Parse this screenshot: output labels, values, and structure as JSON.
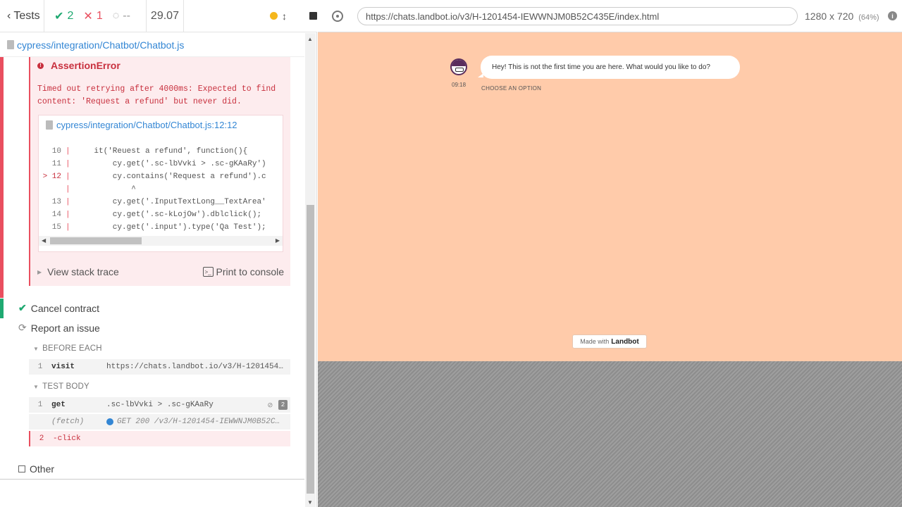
{
  "topbar": {
    "tests_label": "Tests",
    "passed": "2",
    "failed": "1",
    "pending": "--",
    "duration": "29.07"
  },
  "spec_file": "cypress/integration/Chatbot/Chatbot.js",
  "error": {
    "title": "AssertionError",
    "message": "Timed out retrying after 4000ms: Expected to find content: 'Request a refund' but never did.",
    "code_file": "cypress/integration/Chatbot/Chatbot.js:12:12",
    "code_lines": [
      {
        "num": "10",
        "marker": "",
        "code": "    it('Reuest a refund', function(){"
      },
      {
        "num": "11",
        "marker": "",
        "code": "        cy.get('.sc-lbVvki > .sc-gKAaRy')"
      },
      {
        "num": "12",
        "marker": "> ",
        "code": "        cy.contains('Request a refund').c"
      },
      {
        "num": "",
        "marker": "",
        "code": "            ^"
      },
      {
        "num": "13",
        "marker": "",
        "code": "        cy.get('.InputTextLong__TextArea'"
      },
      {
        "num": "14",
        "marker": "",
        "code": "        cy.get('.sc-kLojOw').dblclick();"
      },
      {
        "num": "15",
        "marker": "",
        "code": "        cy.get('.input').type('Qa Test');"
      }
    ],
    "view_stack_trace": "View stack trace",
    "print_to_console": "Print to console"
  },
  "tests": {
    "cancel_contract": "Cancel contract",
    "report_issue": "Report an issue",
    "other": "Other"
  },
  "hooks": {
    "before_each": "BEFORE EACH",
    "test_body": "TEST BODY"
  },
  "commands": {
    "visit": {
      "num": "1",
      "name": "visit",
      "msg": "https://chats.landbot.io/v3/H-1201454…"
    },
    "get": {
      "num": "1",
      "name": "get",
      "msg": ".sc-lbVvki > .sc-gKAaRy",
      "count": "2"
    },
    "fetch": {
      "name": "(fetch)",
      "msg": "GET 200 /v3/H-1201454-IEWWNJM0B52C…"
    },
    "click": {
      "num": "2",
      "name": "-click"
    }
  },
  "browser": {
    "url": "https://chats.landbot.io/v3/H-1201454-IEWWNJM0B52C435E/index.html",
    "viewport": "1280 x 720",
    "scale": "(64%)"
  },
  "chat": {
    "bot_message": "Hey! This is not the first time you are here. What would you like to do?",
    "time": "09:18",
    "choose_option": "CHOOSE AN OPTION",
    "made_with": "Made with",
    "brand": "Landbot"
  },
  "colors": {
    "pass": "#1fa971",
    "fail": "#e94f5f",
    "link": "#3386d4",
    "chat_bg": "#ffcbaa"
  }
}
